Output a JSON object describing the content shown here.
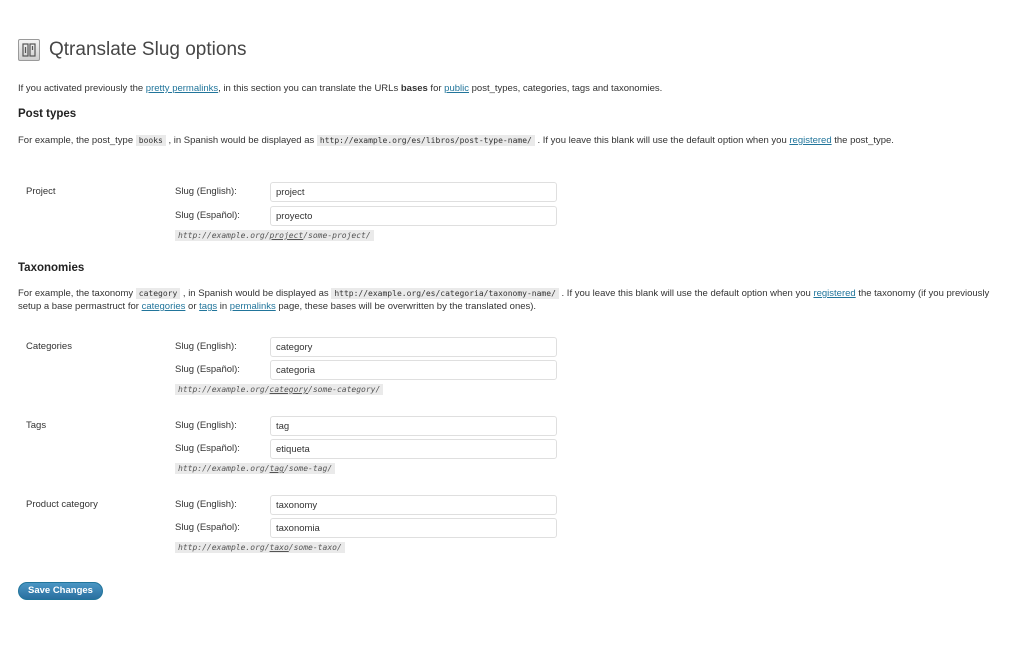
{
  "header": {
    "title": "Qtranslate Slug options",
    "icon": "settings-tools-icon"
  },
  "intro": {
    "p1": "If you activated previously the ",
    "link_pretty": "pretty permalinks",
    "p2": ", in this section you can translate the URLs ",
    "bold": "bases",
    "p3": " for ",
    "link_public": "public",
    "p4": " post_types, categories, tags and taxonomies."
  },
  "post_types": {
    "title": "Post types",
    "d1": "For example, the post_type ",
    "code1": "books",
    "d2": " , in Spanish would be displayed as ",
    "code2": "http://example.org/es/libros/post-type-name/",
    "d3": " . If you leave this blank will use the default option when you ",
    "link_registered": "registered",
    "d4": " the post_type."
  },
  "taxonomies": {
    "title": "Taxonomies",
    "d1": "For example, the taxonomy ",
    "code1": "category",
    "d2": " , in Spanish would be displayed as ",
    "code2": "http://example.org/es/categoria/taxonomy-name/",
    "d3": " . If you leave this blank will use the default option when you ",
    "link_registered": "registered",
    "d4": " the taxonomy (if you previously setup a base permastruct for ",
    "link_categories": "categories",
    "d5": " or ",
    "link_tags": "tags",
    "d6": " in ",
    "link_permalinks": "permalinks",
    "d7": " page, these bases will be overwritten by the translated ones)."
  },
  "labels": {
    "english": "Slug (English):",
    "spanish": "Slug (Español):"
  },
  "groups": {
    "project": {
      "label": "Project",
      "en": "project",
      "es": "proyecto",
      "ex_pre": "http://example.org/",
      "ex_slug": "project",
      "ex_post": "/some-project/"
    },
    "categories": {
      "label": "Categories",
      "en": "category",
      "es": "categoria",
      "ex_pre": "http://example.org/",
      "ex_slug": "category",
      "ex_post": "/some-category/"
    },
    "tags": {
      "label": "Tags",
      "en": "tag",
      "es": "etiqueta",
      "ex_pre": "http://example.org/",
      "ex_slug": "tag",
      "ex_post": "/some-tag/"
    },
    "product_category": {
      "label": "Product category",
      "en": "taxonomy",
      "es": "taxonomia",
      "ex_pre": "http://example.org/",
      "ex_slug": "taxo",
      "ex_post": "/some-taxo/"
    }
  },
  "save_label": "Save Changes"
}
